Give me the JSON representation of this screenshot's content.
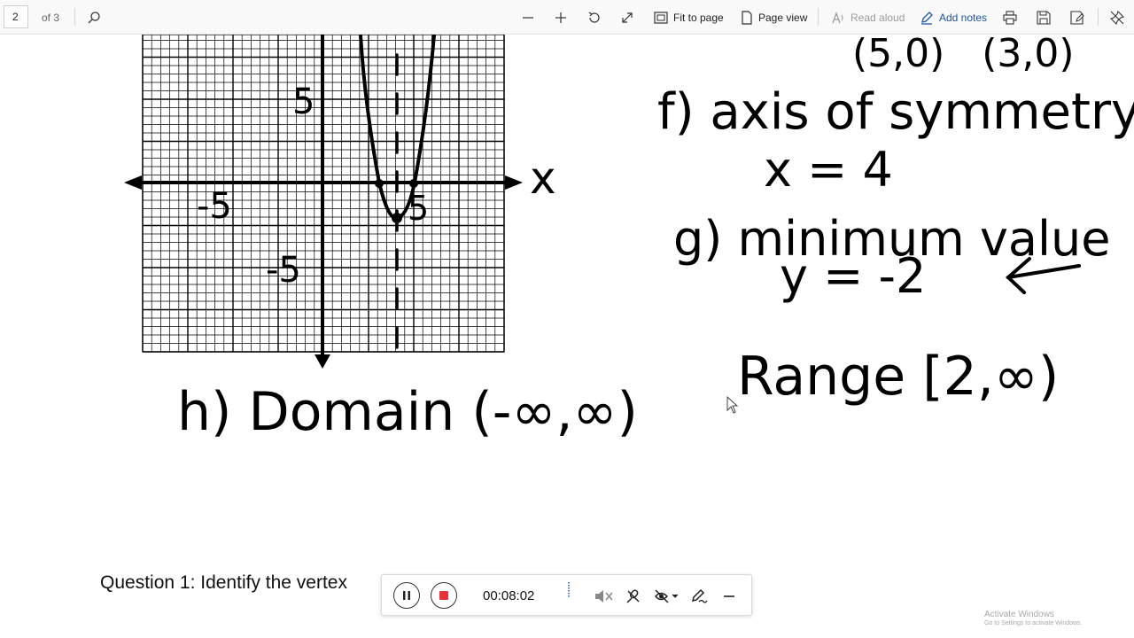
{
  "toolbar": {
    "page_number": "2",
    "page_total": "of 3",
    "fit_to_page": "Fit to page",
    "page_view": "Page view",
    "read_aloud": "Read aloud",
    "add_notes": "Add notes"
  },
  "whiteboard": {
    "axis_x_label": "x",
    "tick_5_y": "5",
    "tick_neg5_y": "-5",
    "tick_neg5_x": "-5",
    "tick_5_x": "5",
    "top_points": "(5,0)   (3,0)",
    "f_label": "f) axis of symmetry",
    "f_value": "x = 4",
    "g_label": "g) minimum value",
    "g_value": "y = -2",
    "h_label": "h) Domain (-∞,∞)",
    "range_label": "Range [2,∞)"
  },
  "question": {
    "text": "Question 1:  Identify the vertex"
  },
  "recorder": {
    "elapsed": "00:08:02"
  },
  "watermark": {
    "title": "Activate Windows",
    "subtitle": "Go to Settings to activate Windows."
  },
  "colors": {
    "accent": "#1e56a0",
    "record_red": "#e8333a",
    "ink": "#000000"
  }
}
